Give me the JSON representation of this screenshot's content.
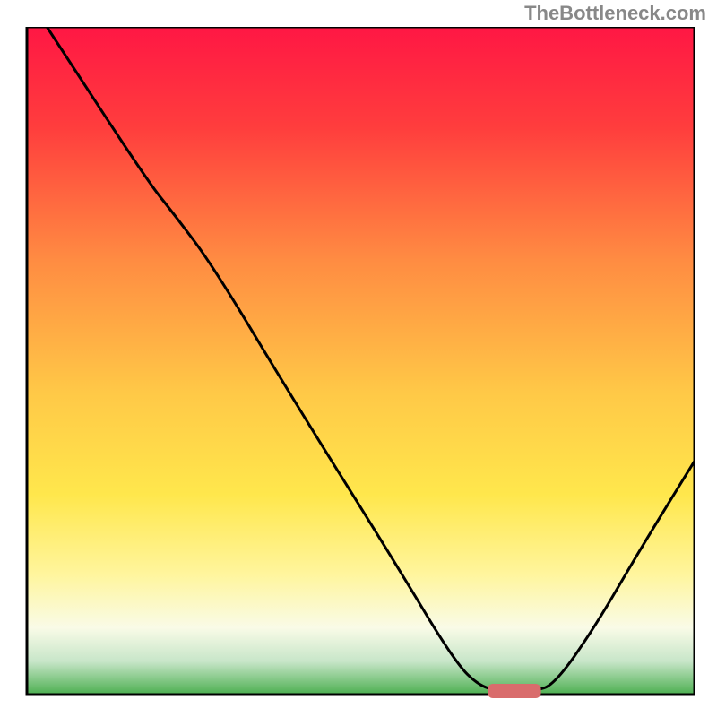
{
  "watermark": "TheBottleneck.com",
  "chart_data": {
    "type": "line",
    "title": "",
    "xlabel": "",
    "ylabel": "",
    "xlim": [
      0,
      100
    ],
    "ylim": [
      0,
      100
    ],
    "background_gradient": {
      "stops": [
        {
          "offset": 0,
          "color": "#ff1744"
        },
        {
          "offset": 15,
          "color": "#ff3d3d"
        },
        {
          "offset": 35,
          "color": "#ff8c42"
        },
        {
          "offset": 55,
          "color": "#ffc947"
        },
        {
          "offset": 70,
          "color": "#ffe74c"
        },
        {
          "offset": 82,
          "color": "#fff59d"
        },
        {
          "offset": 90,
          "color": "#f9fbe7"
        },
        {
          "offset": 95,
          "color": "#c8e6c9"
        },
        {
          "offset": 100,
          "color": "#4caf50"
        }
      ]
    },
    "curve_points": [
      {
        "x": 3,
        "y": 100
      },
      {
        "x": 18,
        "y": 77
      },
      {
        "x": 22,
        "y": 72
      },
      {
        "x": 28,
        "y": 64
      },
      {
        "x": 40,
        "y": 44
      },
      {
        "x": 55,
        "y": 20
      },
      {
        "x": 64,
        "y": 5
      },
      {
        "x": 68,
        "y": 1
      },
      {
        "x": 72,
        "y": 0.5
      },
      {
        "x": 76,
        "y": 0.5
      },
      {
        "x": 79,
        "y": 1.5
      },
      {
        "x": 85,
        "y": 10
      },
      {
        "x": 92,
        "y": 22
      },
      {
        "x": 100,
        "y": 35
      }
    ],
    "marker": {
      "x": 73,
      "y": 0,
      "width": 8,
      "height": 2,
      "color": "#d96c6c"
    },
    "axis_color": "#000000",
    "curve_color": "#000000"
  }
}
